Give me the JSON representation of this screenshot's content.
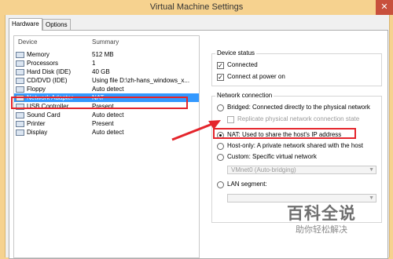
{
  "window": {
    "title": "Virtual Machine Settings",
    "close_icon": "close-icon"
  },
  "tabs": [
    {
      "label": "Hardware",
      "active": true
    },
    {
      "label": "Options",
      "active": false
    }
  ],
  "devices": {
    "col_device": "Device",
    "col_summary": "Summary",
    "rows": [
      {
        "name": "Memory",
        "summary": "512 MB",
        "icon": "memory-icon"
      },
      {
        "name": "Processors",
        "summary": "1",
        "icon": "processor-icon"
      },
      {
        "name": "Hard Disk (IDE)",
        "summary": "40 GB",
        "icon": "hard-disk-icon"
      },
      {
        "name": "CD/DVD (IDE)",
        "summary": "Using file D:\\zh-hans_windows_x...",
        "icon": "cd-dvd-icon"
      },
      {
        "name": "Floppy",
        "summary": "Auto detect",
        "icon": "floppy-icon"
      },
      {
        "name": "Network Adapter",
        "summary": "NAT",
        "icon": "network-adapter-icon",
        "selected": true
      },
      {
        "name": "USB Controller",
        "summary": "Present",
        "icon": "usb-icon"
      },
      {
        "name": "Sound Card",
        "summary": "Auto detect",
        "icon": "sound-card-icon"
      },
      {
        "name": "Printer",
        "summary": "Present",
        "icon": "printer-icon"
      },
      {
        "name": "Display",
        "summary": "Auto detect",
        "icon": "display-icon"
      }
    ]
  },
  "device_status": {
    "title": "Device status",
    "connected": {
      "label": "Connected",
      "checked": true
    },
    "connect_at_power_on": {
      "label": "Connect at power on",
      "checked": true
    }
  },
  "network_connection": {
    "title": "Network connection",
    "bridged": {
      "label": "Bridged: Connected directly to the physical network",
      "checked": false
    },
    "replicate": {
      "label": "Replicate physical network connection state",
      "checked": false
    },
    "nat": {
      "label": "NAT: Used to share the host's IP address",
      "checked": true
    },
    "host_only": {
      "label": "Host-only: A private network shared with the host",
      "checked": false
    },
    "custom": {
      "label": "Custom: Specific virtual network",
      "checked": false
    },
    "custom_select": "VMnet0 (Auto-bridging)",
    "lan_segment": {
      "label": "LAN segment:",
      "checked": false
    },
    "lan_select": ""
  },
  "watermark": {
    "line1": "百科全说",
    "line2": "助你轻松解决"
  },
  "colors": {
    "accent_red": "#e4252c",
    "selection": "#3399ff",
    "title_bg": "#f6d28f"
  }
}
